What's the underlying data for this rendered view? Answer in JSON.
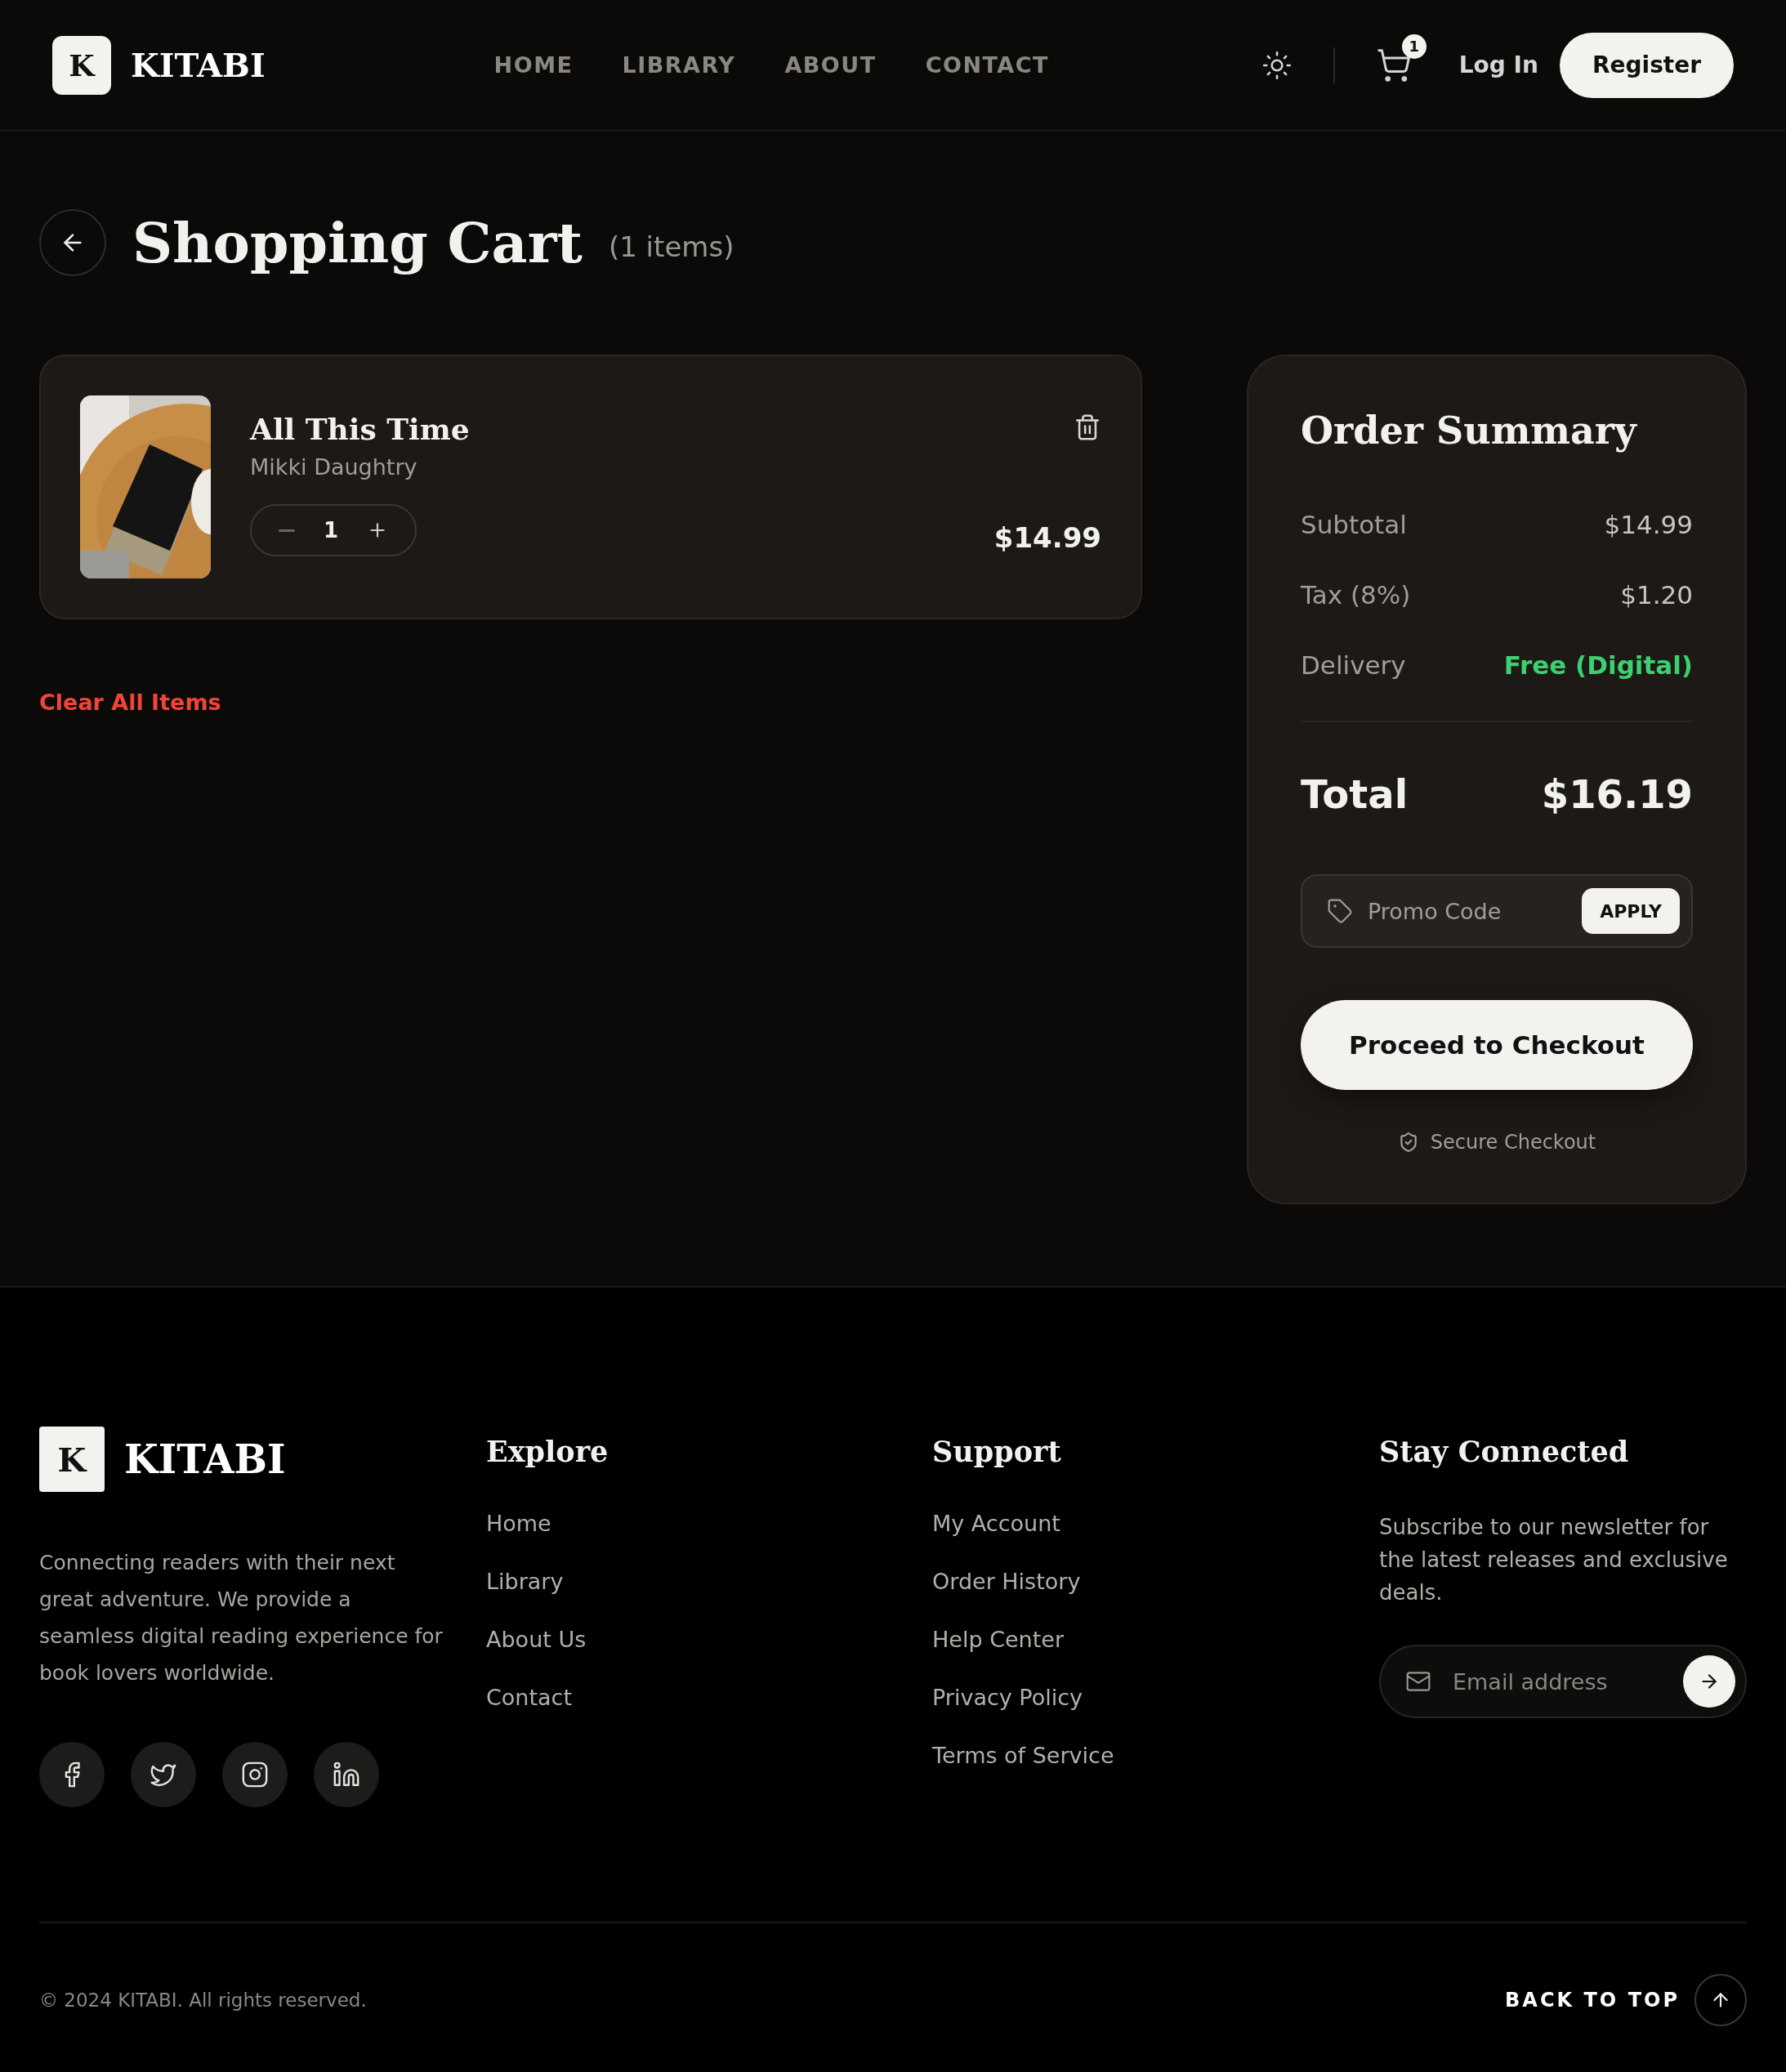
{
  "header": {
    "logo_letter": "K",
    "brand": "KITABI",
    "nav": [
      "HOME",
      "LIBRARY",
      "ABOUT",
      "CONTACT"
    ],
    "cart_count": "1",
    "login": "Log In",
    "register": "Register"
  },
  "page": {
    "title": "Shopping Cart",
    "count": "(1 items)"
  },
  "cart_items": [
    {
      "title": "All This Time",
      "author": "Mikki Daughtry",
      "quantity": "1",
      "price": "$14.99"
    }
  ],
  "clear_all": "Clear All Items",
  "summary": {
    "title": "Order Summary",
    "rows": [
      {
        "label": "Subtotal",
        "value": "$14.99",
        "kind": "plain"
      },
      {
        "label": "Tax (8%)",
        "value": "$1.20",
        "kind": "plain"
      },
      {
        "label": "Delivery",
        "value": "Free (Digital)",
        "kind": "highlight"
      }
    ],
    "total_label": "Total",
    "total_value": "$16.19",
    "promo_placeholder": "Promo Code",
    "apply": "APPLY",
    "checkout": "Proceed to Checkout",
    "secure": "Secure Checkout"
  },
  "footer": {
    "logo_letter": "K",
    "brand": "KITABI",
    "about": "Connecting readers with their next great adventure. We provide a seamless digital reading experience for book lovers worldwide.",
    "socials": [
      {
        "kind": "facebook"
      },
      {
        "kind": "twitter"
      },
      {
        "kind": "instagram"
      },
      {
        "kind": "linkedin"
      }
    ],
    "columns": [
      {
        "title": "Explore",
        "links": [
          "Home",
          "Library",
          "About Us",
          "Contact"
        ]
      },
      {
        "title": "Support",
        "links": [
          "My Account",
          "Order History",
          "Help Center",
          "Privacy Policy",
          "Terms of Service"
        ]
      }
    ],
    "newsletter": {
      "title": "Stay Connected",
      "text": "Subscribe to our newsletter for the latest releases and exclusive deals.",
      "placeholder": "Email address"
    },
    "copyright": "© 2024 KITABI. All rights reserved.",
    "back_to_top": "BACK TO TOP"
  }
}
